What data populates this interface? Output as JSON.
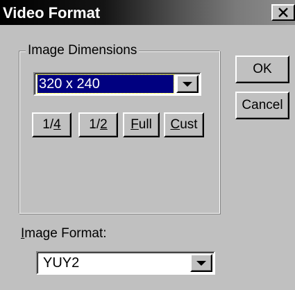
{
  "window": {
    "title": "Video Format",
    "close_icon": "close-x-icon"
  },
  "dimensions_group": {
    "legend": "Image Dimensions",
    "size_select": {
      "value": "320 x 240"
    },
    "size_buttons": [
      {
        "label": "1/4",
        "mnemonic": "4"
      },
      {
        "label": "1/2",
        "mnemonic": "2"
      },
      {
        "label": "Full",
        "mnemonic": "F"
      },
      {
        "label": "Cust",
        "mnemonic": "C"
      }
    ]
  },
  "actions": {
    "ok_label": "OK",
    "cancel_label": "Cancel"
  },
  "format": {
    "label": "Image Format:",
    "label_mnemonic": "I",
    "select": {
      "value": "YUY2"
    }
  },
  "colors": {
    "face": "#c0c0c0",
    "highlight": "#000080"
  }
}
